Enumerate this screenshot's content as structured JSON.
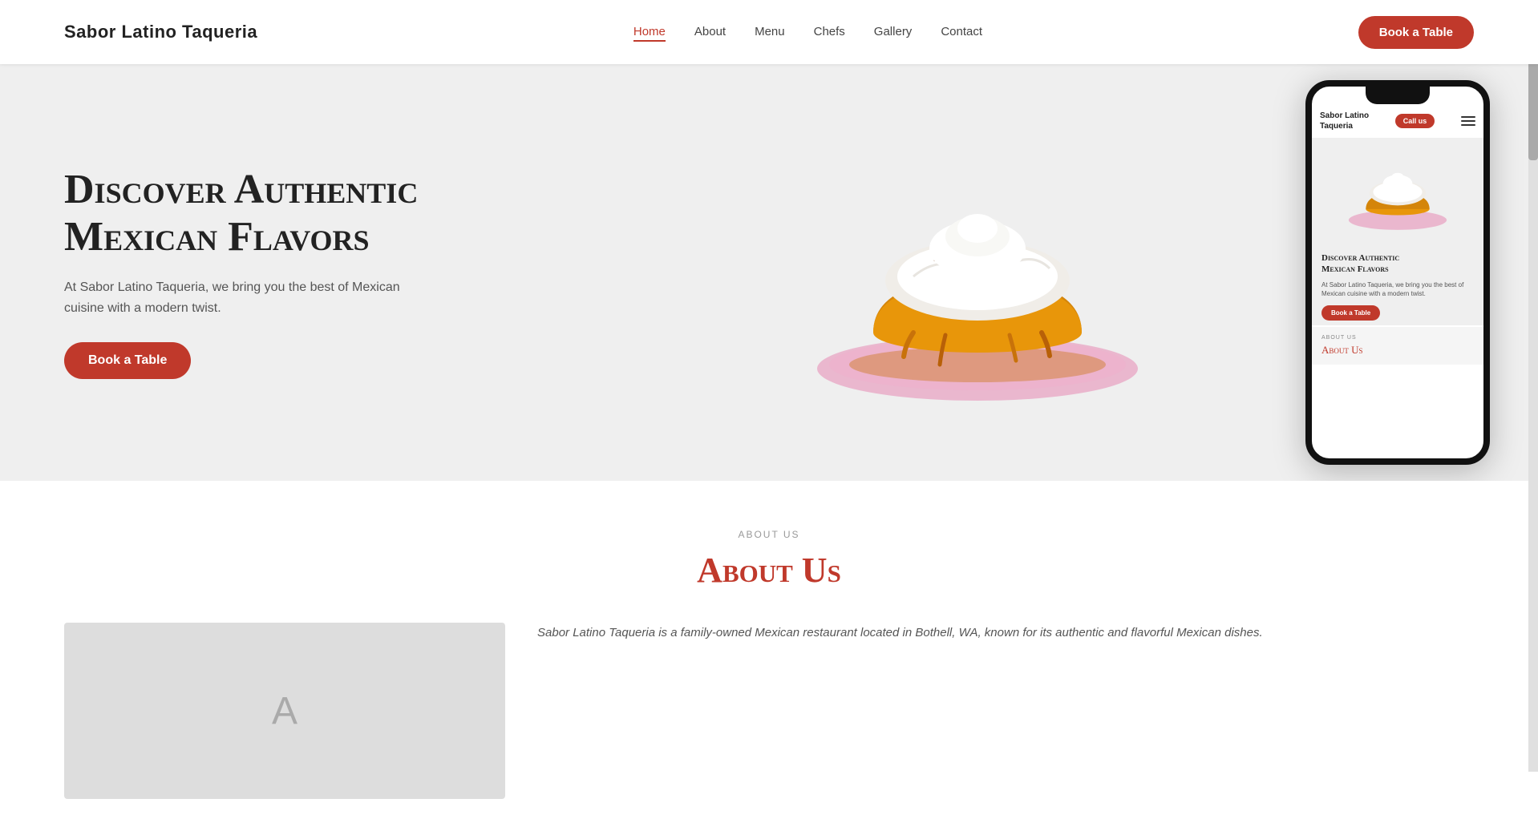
{
  "header": {
    "logo": "Sabor Latino Taqueria",
    "nav": [
      {
        "label": "Home",
        "active": true
      },
      {
        "label": "About",
        "active": false
      },
      {
        "label": "Menu",
        "active": false
      },
      {
        "label": "Chefs",
        "active": false
      },
      {
        "label": "Gallery",
        "active": false
      },
      {
        "label": "Contact",
        "active": false
      }
    ],
    "book_btn": "Book a Table"
  },
  "hero": {
    "title_line1": "Discover Authentic",
    "title_line2": "Mexican Flavors",
    "description": "At Sabor Latino Taqueria, we bring you the best of Mexican cuisine with a modern twist.",
    "book_btn": "Book a Table"
  },
  "mockup": {
    "logo_line1": "Sabor Latino",
    "logo_line2": "Taqueria",
    "call_btn": "Call us",
    "hero_title_line1": "Discover Authentic",
    "hero_title_line2": "Mexican Flavors",
    "hero_desc": "At Sabor Latino Taqueria, we bring you the best of Mexican cuisine with a modern twist.",
    "book_btn": "Book a Table",
    "about_label": "About Us",
    "about_title": "About Us"
  },
  "about": {
    "label": "About Us",
    "title": "About Us",
    "body": "Sabor Latino Taqueria is a family-owned Mexican restaurant located in Bothell, WA, known for its authentic and flavorful Mexican dishes."
  },
  "colors": {
    "accent": "#c0392b",
    "bg_hero": "#efefef",
    "text_dark": "#222222",
    "text_muted": "#555555"
  }
}
